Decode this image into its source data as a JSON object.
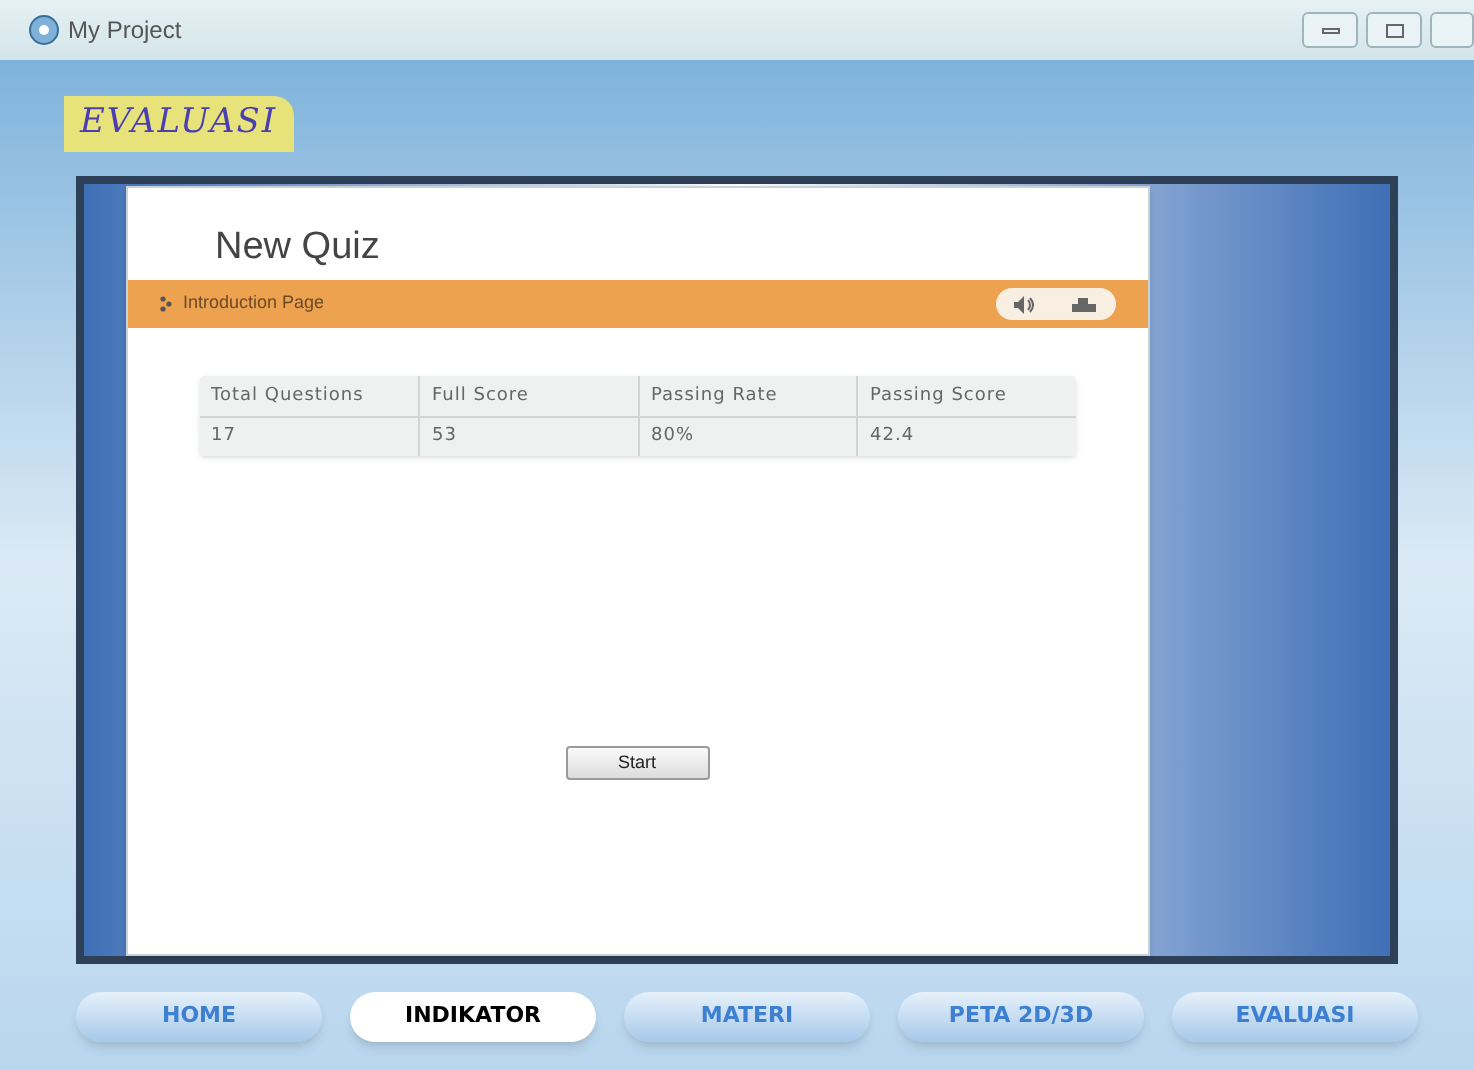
{
  "window": {
    "title": "My Project"
  },
  "section_label": "EVALUASI",
  "quiz": {
    "title": "New Quiz",
    "page": "Introduction Page",
    "table": {
      "columns": [
        "Total Questions",
        "Full Score",
        "Passing Rate",
        "Passing Score"
      ],
      "rows": [
        [
          "17",
          "53",
          "80%",
          "42.4"
        ]
      ]
    },
    "start_button": "Start"
  },
  "nav": [
    {
      "label": "HOME",
      "selected": false
    },
    {
      "label": "INDIKATOR",
      "selected": true
    },
    {
      "label": "MATERI",
      "selected": false
    },
    {
      "label": "PETA 2D/3D",
      "selected": false
    },
    {
      "label": "EVALUASI",
      "selected": false
    }
  ]
}
